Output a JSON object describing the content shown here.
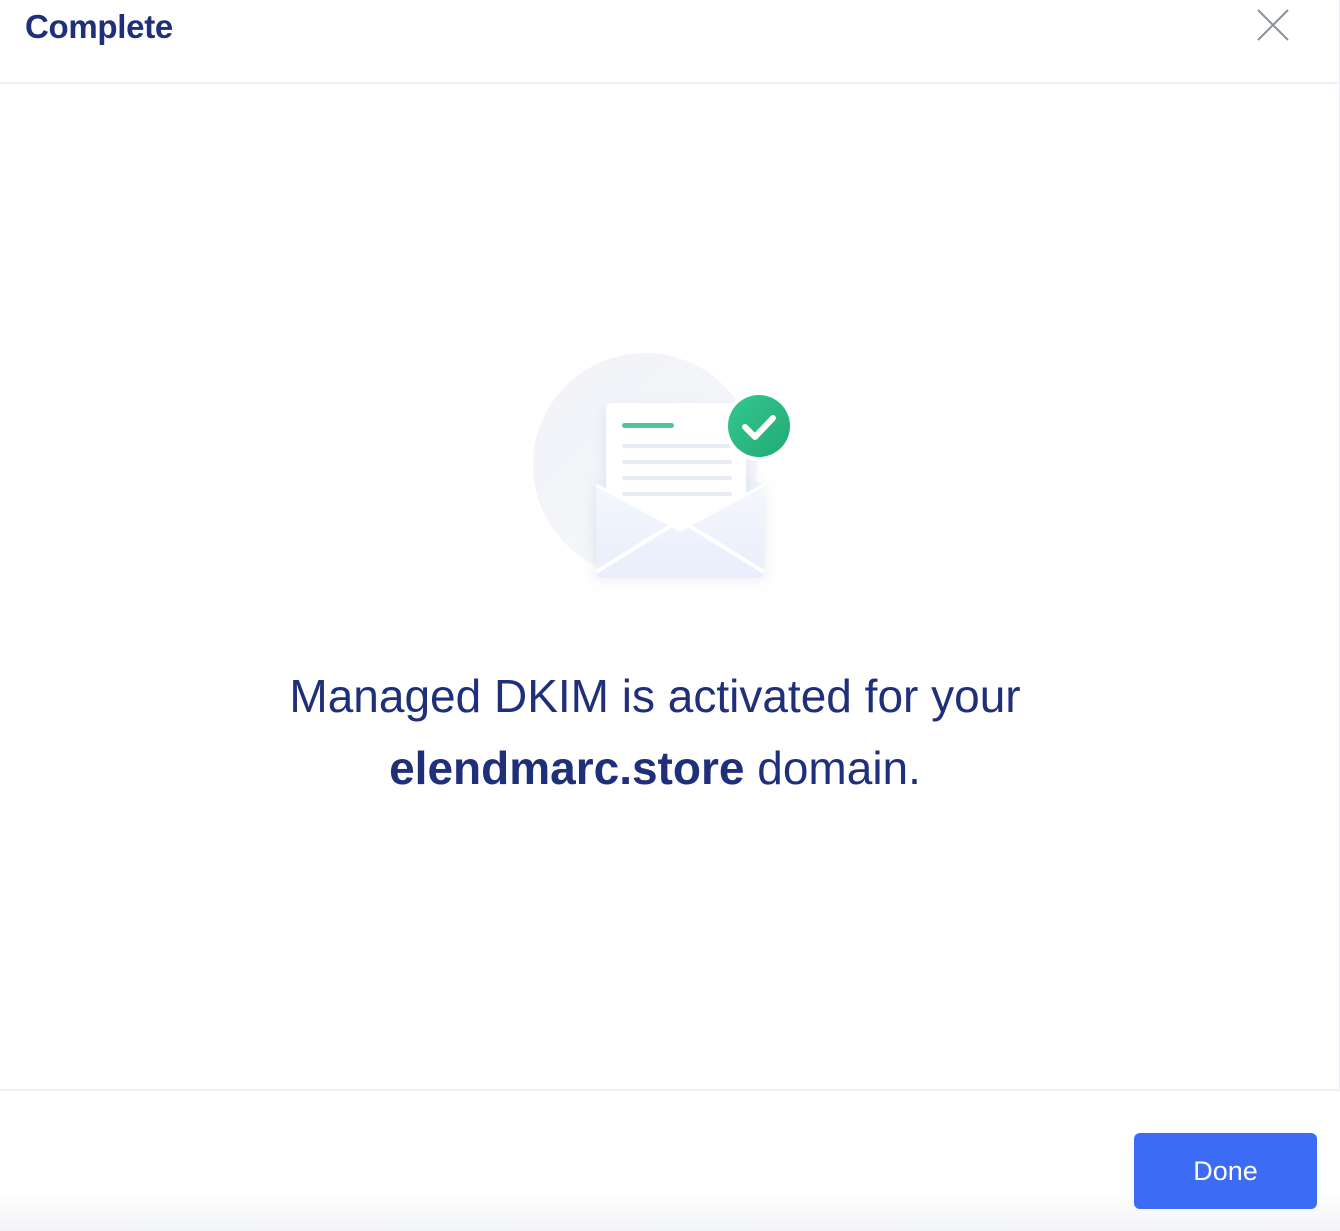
{
  "dialog": {
    "title": "Complete",
    "close_icon": "close-icon"
  },
  "illustration": {
    "icon": "envelope-check-icon",
    "check_color": "#2ebd85",
    "accent_color": "#4ac79a"
  },
  "message": {
    "line1": "Managed DKIM is activated for your",
    "domain": "elendmarc.store",
    "line2_suffix": " domain."
  },
  "footer": {
    "done_label": "Done",
    "done_color": "#3c6bf5"
  },
  "colors": {
    "title": "#1f2f7a",
    "text": "#1f2f7a"
  }
}
